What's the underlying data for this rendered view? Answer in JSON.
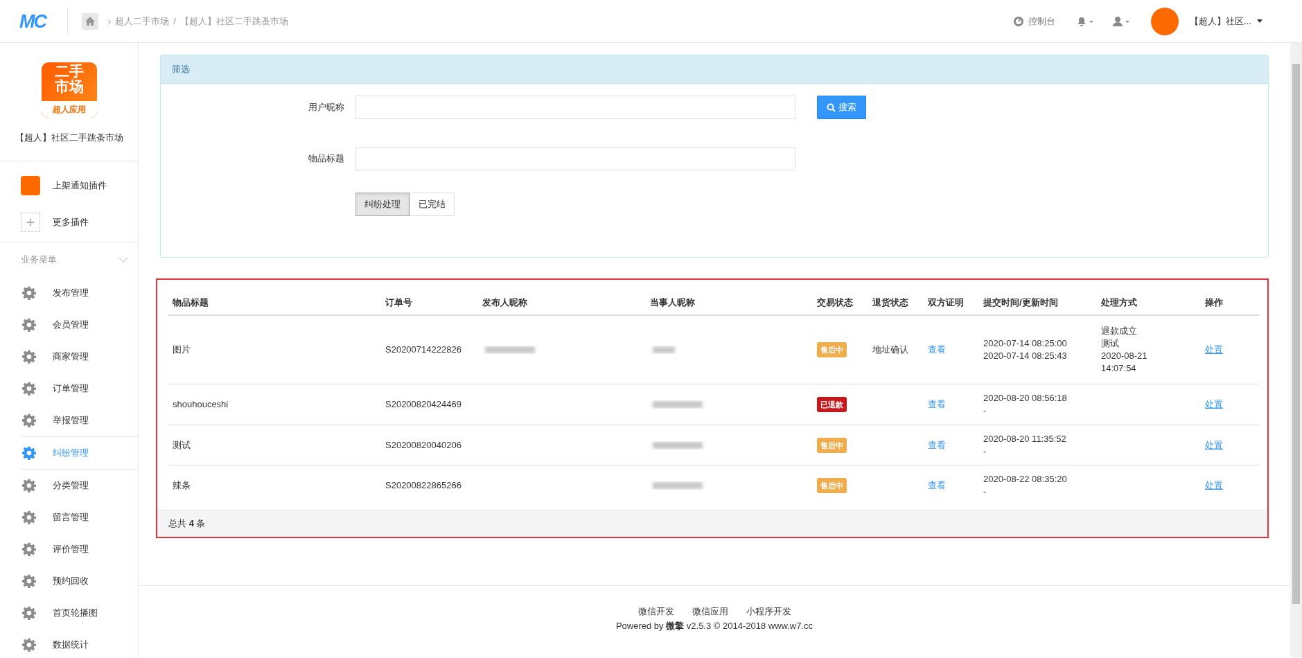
{
  "header": {
    "logo": "MC",
    "breadcrumb_chevron": "›",
    "breadcrumb_separator": "/",
    "breadcrumb": [
      {
        "label": "超人二手市场"
      },
      {
        "label": "【超人】社区二手跳蚤市场"
      }
    ],
    "console": "控制台",
    "account": "【超人】社区..."
  },
  "sidebar": {
    "app_logo": {
      "line1": "二手",
      "line2": "市场",
      "tag": "超人应用"
    },
    "app_name": "【超人】社区二手跳蚤市场",
    "plugins": [
      {
        "kind": "app",
        "label": "上架通知插件"
      },
      {
        "kind": "add",
        "label": "更多插件"
      }
    ],
    "menu_title": "业务菜单",
    "items": [
      {
        "label": "发布管理",
        "selected": false
      },
      {
        "label": "会员管理",
        "selected": false
      },
      {
        "label": "商家管理",
        "selected": false
      },
      {
        "label": "订单管理",
        "selected": false
      },
      {
        "label": "举报管理",
        "selected": false
      },
      {
        "label": "纠纷管理",
        "selected": true
      },
      {
        "label": "分类管理",
        "selected": false
      },
      {
        "label": "留言管理",
        "selected": false
      },
      {
        "label": "评价管理",
        "selected": false
      },
      {
        "label": "预约回收",
        "selected": false
      },
      {
        "label": "首页轮播图",
        "selected": false
      },
      {
        "label": "数据统计",
        "selected": false
      }
    ]
  },
  "filter": {
    "title": "筛选",
    "fields": [
      {
        "label": "用户昵称"
      },
      {
        "label": "物品标题"
      }
    ],
    "search_button": "搜索",
    "segments": [
      {
        "label": "纠纷处理",
        "selected": true
      },
      {
        "label": "已完结",
        "selected": false
      }
    ]
  },
  "table": {
    "columns": [
      "物品标题",
      "订单号",
      "发布人昵称",
      "当事人昵称",
      "交易状态",
      "退货状态",
      "双方证明",
      "提交时间/更新时间",
      "处理方式",
      "操作"
    ],
    "rows": [
      {
        "title": "图片",
        "order_no": "S20200714222826",
        "publisher_redacted": true,
        "party_redacted": true,
        "status": {
          "label": "售后中",
          "color": "#f0ad4e"
        },
        "return_status": "地址确认",
        "proof": "查看",
        "times": [
          "2020-07-14 08:25:00",
          "2020-07-14 08:25:43"
        ],
        "handling": [
          "退款成立",
          "测试",
          "2020-08-21",
          "14:07:54"
        ],
        "action": "处置"
      },
      {
        "title": "shouhouceshi",
        "order_no": "S20200820424469",
        "publisher_redacted": false,
        "party_redacted": true,
        "status": {
          "label": "已退款",
          "color": "#c9171e"
        },
        "proof": "查看",
        "times": [
          "2020-08-20 08:56:18",
          "-"
        ],
        "action": "处置"
      },
      {
        "title": "测试",
        "order_no": "S20200820040206",
        "publisher_redacted": false,
        "party_redacted": true,
        "status": {
          "label": "售后中",
          "color": "#f0ad4e"
        },
        "proof": "查看",
        "times": [
          "2020-08-20 11:35:52",
          "-"
        ],
        "action": "处置"
      },
      {
        "title": "辣条",
        "order_no": "S20200822865266",
        "publisher_redacted": false,
        "party_redacted": true,
        "status": {
          "label": "售后中",
          "color": "#f0ad4e"
        },
        "proof": "查看",
        "times": [
          "2020-08-22 08:35:20",
          "-"
        ],
        "action": "处置"
      }
    ],
    "total": "总共 **4** 条"
  },
  "footer": {
    "links": [
      "微信开发",
      "微信应用",
      "小程序开发"
    ],
    "powered": "Powered by **微擎** v2.5.3 © 2014-2018 www.w7.cc"
  }
}
